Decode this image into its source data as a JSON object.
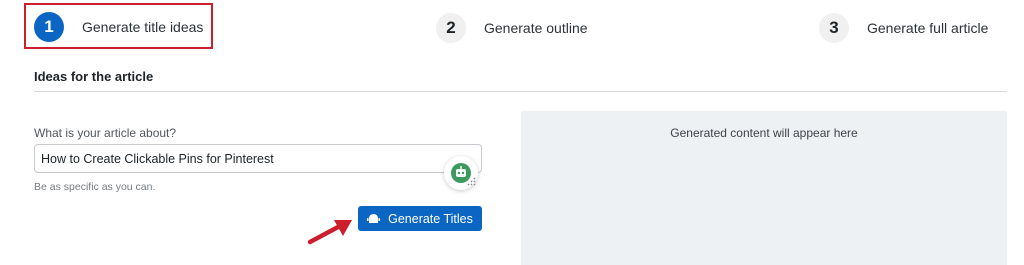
{
  "steps": [
    {
      "number": "1",
      "label": "Generate title ideas",
      "active": true
    },
    {
      "number": "2",
      "label": "Generate outline",
      "active": false
    },
    {
      "number": "3",
      "label": "Generate full article",
      "active": false
    }
  ],
  "section": {
    "title": "Ideas for the article"
  },
  "form": {
    "field_label": "What is your article about?",
    "topic_value": "How to Create Clickable Pins for Pinterest",
    "hint": "Be as specific as you can.",
    "submit_label": "Generate Titles"
  },
  "output_panel": {
    "placeholder": "Generated content will appear here"
  },
  "colors": {
    "primary": "#0a66c2",
    "highlight": "#cc1f2d",
    "panel_bg": "#eef1f4",
    "badge_green": "#3c9a5f"
  },
  "icons": {
    "button_icon": "robot-icon",
    "badge_icon": "grammar-assistant-icon",
    "annotation": "red-arrow-icon"
  }
}
